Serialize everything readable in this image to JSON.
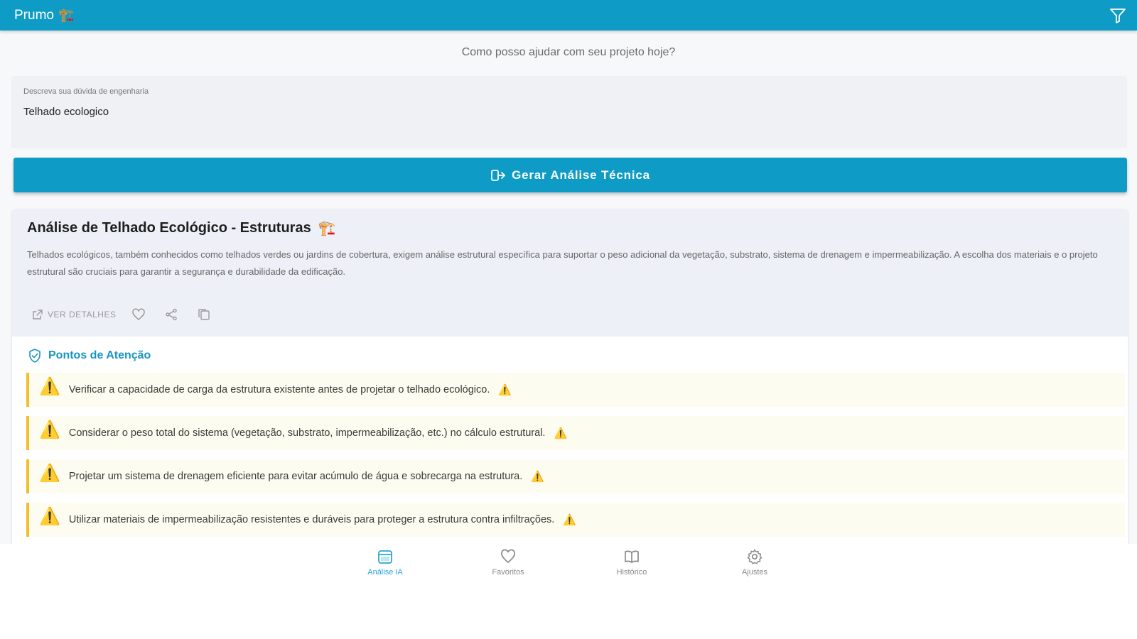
{
  "app": {
    "title": "Prumo",
    "title_emoji": "🏗️"
  },
  "colors": {
    "primary": "#0e9cc6",
    "accent": "#1795c2",
    "warning": "#f4bd2a"
  },
  "prompt": "Como posso ajudar com seu projeto hoje?",
  "input": {
    "label": "Descreva sua dúvida de engenharia",
    "value": "Telhado ecologico"
  },
  "generate_button": {
    "label": "Gerar Análise Técnica",
    "icon": "sparkle-wand-icon"
  },
  "result": {
    "title": "Análise de Telhado Ecológico - Estruturas",
    "title_emoji": "🏗️",
    "description": "Telhados ecológicos, também conhecidos como telhados verdes ou jardins de cobertura, exigem análise estrutural específica para suportar o peso adicional da vegetação, substrato, sistema de drenagem e impermeabilização. A escolha dos materiais e o projeto estrutural são cruciais para garantir a segurança e durabilidade da edificação.",
    "actions": {
      "details_label": "VER DETALHES"
    }
  },
  "attention": {
    "title": "Pontos de Atenção",
    "items": [
      "Verificar a capacidade de carga da estrutura existente antes de projetar o telhado ecológico.",
      "Considerar o peso total do sistema (vegetação, substrato, impermeabilização, etc.) no cálculo estrutural.",
      "Projetar um sistema de drenagem eficiente para evitar acúmulo de água e sobrecarga na estrutura.",
      "Utilizar materiais de impermeabilização resistentes e duráveis para proteger a estrutura contra infiltrações."
    ],
    "item_icon": "⚠️",
    "item_tail_icon": "⚠️"
  },
  "nav": [
    {
      "label": "Análise IA",
      "icon": "calendar-icon",
      "active": true
    },
    {
      "label": "Favoritos",
      "icon": "heart-icon",
      "active": false
    },
    {
      "label": "Histórico",
      "icon": "book-icon",
      "active": false
    },
    {
      "label": "Ajustes",
      "icon": "gear-icon",
      "active": false
    }
  ]
}
